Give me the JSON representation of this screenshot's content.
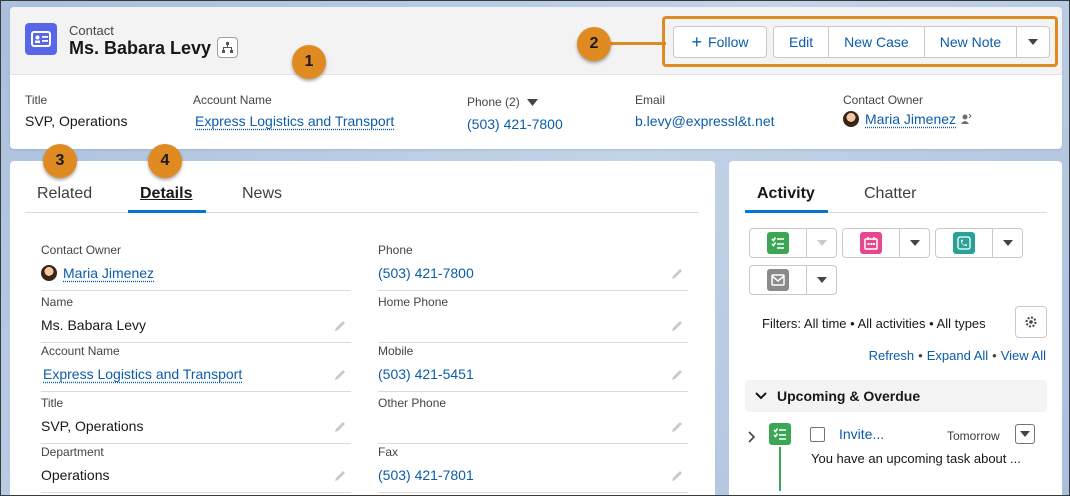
{
  "header": {
    "record_type": "Contact",
    "record_name": "Ms. Babara Levy",
    "actions": {
      "follow": "Follow",
      "edit": "Edit",
      "new_case": "New Case",
      "new_note": "New Note"
    },
    "fields": {
      "title_label": "Title",
      "title_value": "SVP, Operations",
      "account_label": "Account Name",
      "account_value": "Express Logistics and Transport",
      "phone_label": "Phone (2)",
      "phone_value": "(503) 421-7800",
      "email_label": "Email",
      "email_value": "b.levy@expressl&t.net",
      "owner_label": "Contact Owner",
      "owner_value": "Maria Jimenez"
    }
  },
  "callouts": [
    "1",
    "2",
    "3",
    "4"
  ],
  "details": {
    "tabs": [
      "Related",
      "Details",
      "News"
    ],
    "active_tab": "Details",
    "left_fields": [
      {
        "label": "Contact Owner",
        "value": "Maria Jimenez"
      },
      {
        "label": "Name",
        "value": "Ms. Babara Levy"
      },
      {
        "label": "Account Name",
        "value": "Express Logistics and Transport"
      },
      {
        "label": "Title",
        "value": "SVP, Operations"
      },
      {
        "label": "Department",
        "value": "Operations"
      }
    ],
    "right_fields": [
      {
        "label": "Phone",
        "value": "(503) 421-7800"
      },
      {
        "label": "Home Phone",
        "value": ""
      },
      {
        "label": "Mobile",
        "value": "(503) 421-5451"
      },
      {
        "label": "Other Phone",
        "value": ""
      },
      {
        "label": "Fax",
        "value": "(503) 421-7801"
      }
    ]
  },
  "activity": {
    "tabs": [
      "Activity",
      "Chatter"
    ],
    "active_tab": "Activity",
    "filters_text": "Filters: All time • All activities • All types",
    "links": [
      "Refresh",
      "Expand All",
      "View All"
    ],
    "section_title": "Upcoming & Overdue",
    "task": {
      "title": "Invite...",
      "due": "Tomorrow",
      "description": "You have an upcoming task about ..."
    },
    "colors": {
      "task": "#3ba755",
      "event": "#e6488f",
      "call": "#2aa198",
      "email": "#8a8a8a"
    }
  },
  "colors": {
    "accent": "#e08b22",
    "link": "#0b5cab",
    "brand": "#0176d3",
    "contact_icon": "#5867e8"
  }
}
